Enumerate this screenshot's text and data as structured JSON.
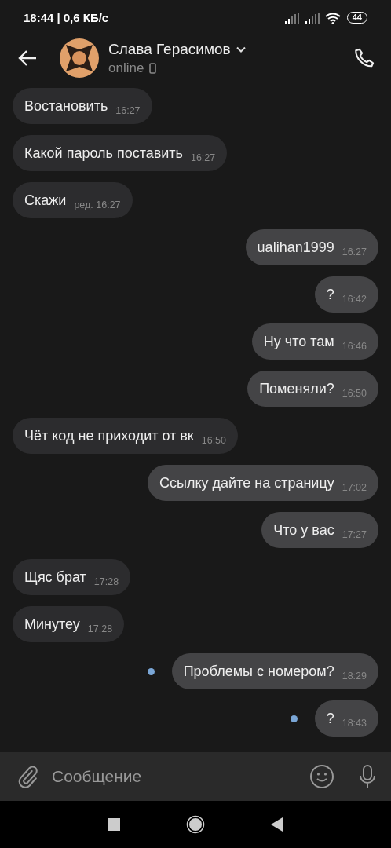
{
  "status_bar": {
    "time": "18:44",
    "speed": "| 0,6 КБ/с",
    "battery": "44"
  },
  "header": {
    "name": "Слава Герасимов",
    "status": "online"
  },
  "messages": [
    {
      "kind": "in",
      "text": "Востановить",
      "time": "16:27",
      "unread": false
    },
    {
      "kind": "in",
      "text": "Какой пароль поставить",
      "time": "16:27",
      "unread": false
    },
    {
      "kind": "in",
      "text": "Скажи",
      "time": "ред. 16:27",
      "unread": false
    },
    {
      "kind": "out",
      "text": "ualihan1999",
      "time": "16:27",
      "unread": false
    },
    {
      "kind": "out",
      "text": "?",
      "time": "16:42",
      "unread": false
    },
    {
      "kind": "out",
      "text": "Ну что там",
      "time": "16:46",
      "unread": false
    },
    {
      "kind": "out",
      "text": "Поменяли?",
      "time": "16:50",
      "unread": false
    },
    {
      "kind": "in",
      "text": "Чёт код не приходит от вк",
      "time": "16:50",
      "unread": false
    },
    {
      "kind": "out",
      "text": "Ссылку дайте на страницу",
      "time": "17:02",
      "unread": false
    },
    {
      "kind": "out",
      "text": "Что у вас",
      "time": "17:27",
      "unread": false
    },
    {
      "kind": "in",
      "text": "Щяс брат",
      "time": "17:28",
      "unread": false
    },
    {
      "kind": "in",
      "text": "Минутеу",
      "time": "17:28",
      "unread": false
    },
    {
      "kind": "out",
      "text": "Проблемы с номером?",
      "time": "18:29",
      "unread": true
    },
    {
      "kind": "out",
      "text": "?",
      "time": "18:43",
      "unread": true
    }
  ],
  "composer": {
    "placeholder": "Сообщение"
  }
}
